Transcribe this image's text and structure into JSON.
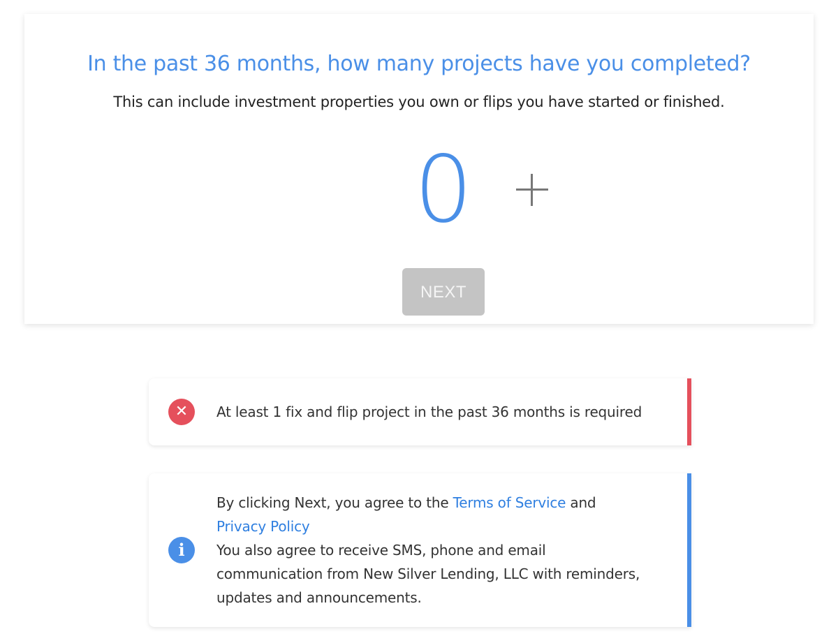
{
  "question": {
    "title": "In the past 36 months, how many projects have you completed?",
    "subtitle": "This can include investment properties you own or flips you have started or finished."
  },
  "counter": {
    "value": "0",
    "increment_icon": "plus-icon"
  },
  "next_button": {
    "label": "NEXT",
    "state": "disabled"
  },
  "error_alert": {
    "icon": "close-circle-icon",
    "icon_glyph": "✕",
    "message": "At least 1 fix and flip project in the past 36 months is required"
  },
  "info_alert": {
    "icon": "info-circle-icon",
    "icon_glyph": "i",
    "text_before": "By clicking Next, you agree to the ",
    "terms_link": "Terms of Service",
    "text_and": " and",
    "privacy_link": "Privacy Policy",
    "consent_text": "You also agree to receive SMS, phone and email communication from New Silver Lending, LLC with reminders, updates and announcements."
  },
  "colors": {
    "accent": "#4a8fe7",
    "error": "#e5505c",
    "disabled_button": "#c4c4c4",
    "link": "#2f7fe0"
  }
}
